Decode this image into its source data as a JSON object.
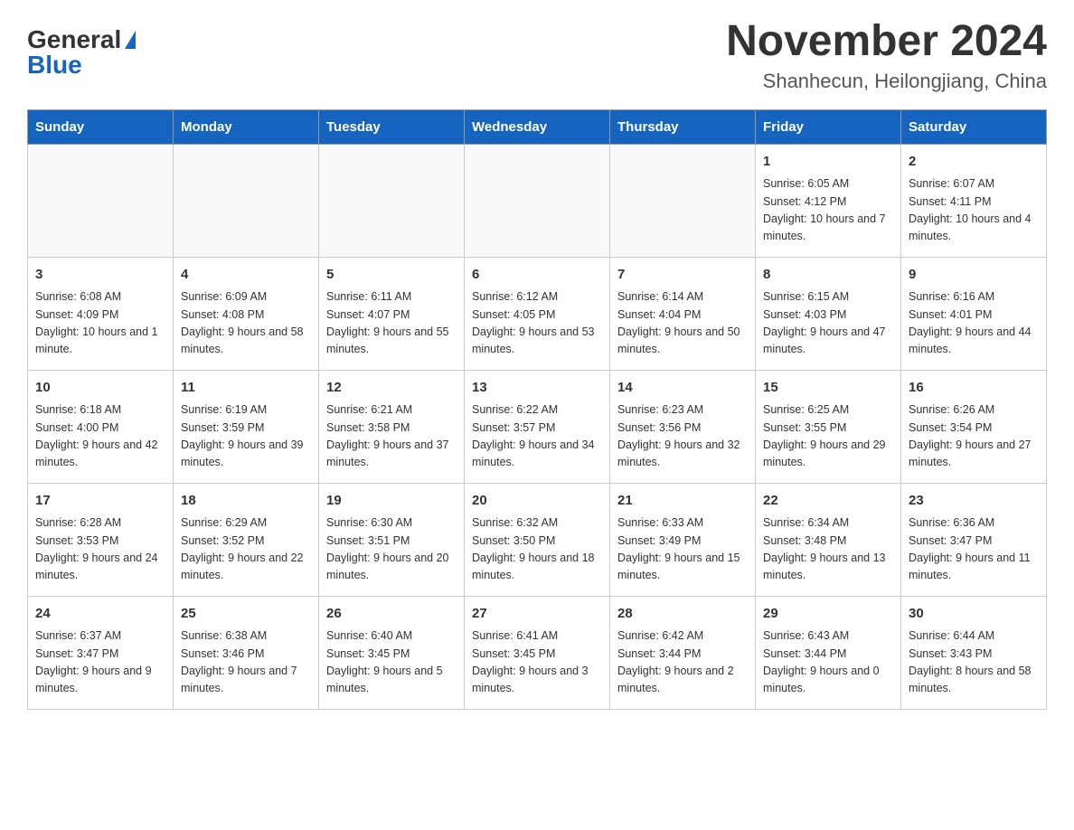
{
  "logo": {
    "general": "General",
    "blue": "Blue"
  },
  "title": "November 2024",
  "subtitle": "Shanhecun, Heilongjiang, China",
  "weekdays": [
    "Sunday",
    "Monday",
    "Tuesday",
    "Wednesday",
    "Thursday",
    "Friday",
    "Saturday"
  ],
  "weeks": [
    [
      {
        "day": "",
        "info": ""
      },
      {
        "day": "",
        "info": ""
      },
      {
        "day": "",
        "info": ""
      },
      {
        "day": "",
        "info": ""
      },
      {
        "day": "",
        "info": ""
      },
      {
        "day": "1",
        "info": "Sunrise: 6:05 AM\nSunset: 4:12 PM\nDaylight: 10 hours and 7 minutes."
      },
      {
        "day": "2",
        "info": "Sunrise: 6:07 AM\nSunset: 4:11 PM\nDaylight: 10 hours and 4 minutes."
      }
    ],
    [
      {
        "day": "3",
        "info": "Sunrise: 6:08 AM\nSunset: 4:09 PM\nDaylight: 10 hours and 1 minute."
      },
      {
        "day": "4",
        "info": "Sunrise: 6:09 AM\nSunset: 4:08 PM\nDaylight: 9 hours and 58 minutes."
      },
      {
        "day": "5",
        "info": "Sunrise: 6:11 AM\nSunset: 4:07 PM\nDaylight: 9 hours and 55 minutes."
      },
      {
        "day": "6",
        "info": "Sunrise: 6:12 AM\nSunset: 4:05 PM\nDaylight: 9 hours and 53 minutes."
      },
      {
        "day": "7",
        "info": "Sunrise: 6:14 AM\nSunset: 4:04 PM\nDaylight: 9 hours and 50 minutes."
      },
      {
        "day": "8",
        "info": "Sunrise: 6:15 AM\nSunset: 4:03 PM\nDaylight: 9 hours and 47 minutes."
      },
      {
        "day": "9",
        "info": "Sunrise: 6:16 AM\nSunset: 4:01 PM\nDaylight: 9 hours and 44 minutes."
      }
    ],
    [
      {
        "day": "10",
        "info": "Sunrise: 6:18 AM\nSunset: 4:00 PM\nDaylight: 9 hours and 42 minutes."
      },
      {
        "day": "11",
        "info": "Sunrise: 6:19 AM\nSunset: 3:59 PM\nDaylight: 9 hours and 39 minutes."
      },
      {
        "day": "12",
        "info": "Sunrise: 6:21 AM\nSunset: 3:58 PM\nDaylight: 9 hours and 37 minutes."
      },
      {
        "day": "13",
        "info": "Sunrise: 6:22 AM\nSunset: 3:57 PM\nDaylight: 9 hours and 34 minutes."
      },
      {
        "day": "14",
        "info": "Sunrise: 6:23 AM\nSunset: 3:56 PM\nDaylight: 9 hours and 32 minutes."
      },
      {
        "day": "15",
        "info": "Sunrise: 6:25 AM\nSunset: 3:55 PM\nDaylight: 9 hours and 29 minutes."
      },
      {
        "day": "16",
        "info": "Sunrise: 6:26 AM\nSunset: 3:54 PM\nDaylight: 9 hours and 27 minutes."
      }
    ],
    [
      {
        "day": "17",
        "info": "Sunrise: 6:28 AM\nSunset: 3:53 PM\nDaylight: 9 hours and 24 minutes."
      },
      {
        "day": "18",
        "info": "Sunrise: 6:29 AM\nSunset: 3:52 PM\nDaylight: 9 hours and 22 minutes."
      },
      {
        "day": "19",
        "info": "Sunrise: 6:30 AM\nSunset: 3:51 PM\nDaylight: 9 hours and 20 minutes."
      },
      {
        "day": "20",
        "info": "Sunrise: 6:32 AM\nSunset: 3:50 PM\nDaylight: 9 hours and 18 minutes."
      },
      {
        "day": "21",
        "info": "Sunrise: 6:33 AM\nSunset: 3:49 PM\nDaylight: 9 hours and 15 minutes."
      },
      {
        "day": "22",
        "info": "Sunrise: 6:34 AM\nSunset: 3:48 PM\nDaylight: 9 hours and 13 minutes."
      },
      {
        "day": "23",
        "info": "Sunrise: 6:36 AM\nSunset: 3:47 PM\nDaylight: 9 hours and 11 minutes."
      }
    ],
    [
      {
        "day": "24",
        "info": "Sunrise: 6:37 AM\nSunset: 3:47 PM\nDaylight: 9 hours and 9 minutes."
      },
      {
        "day": "25",
        "info": "Sunrise: 6:38 AM\nSunset: 3:46 PM\nDaylight: 9 hours and 7 minutes."
      },
      {
        "day": "26",
        "info": "Sunrise: 6:40 AM\nSunset: 3:45 PM\nDaylight: 9 hours and 5 minutes."
      },
      {
        "day": "27",
        "info": "Sunrise: 6:41 AM\nSunset: 3:45 PM\nDaylight: 9 hours and 3 minutes."
      },
      {
        "day": "28",
        "info": "Sunrise: 6:42 AM\nSunset: 3:44 PM\nDaylight: 9 hours and 2 minutes."
      },
      {
        "day": "29",
        "info": "Sunrise: 6:43 AM\nSunset: 3:44 PM\nDaylight: 9 hours and 0 minutes."
      },
      {
        "day": "30",
        "info": "Sunrise: 6:44 AM\nSunset: 3:43 PM\nDaylight: 8 hours and 58 minutes."
      }
    ]
  ]
}
